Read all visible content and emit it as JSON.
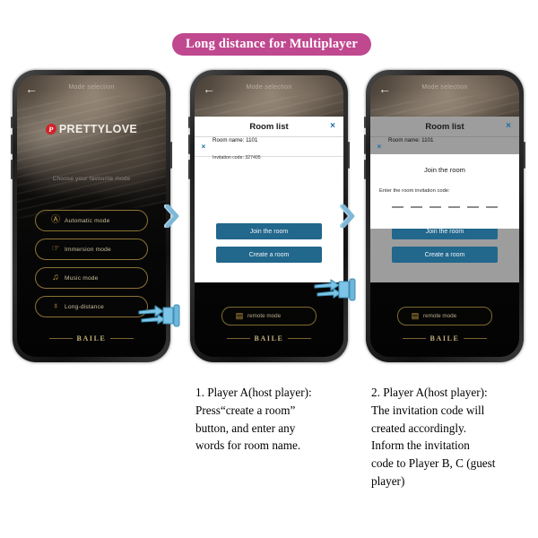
{
  "banner": {
    "text": "Long distance for Multiplayer"
  },
  "app": {
    "header": {
      "back_icon": "back-arrow-icon",
      "title": "Mode selection"
    },
    "logo": {
      "mark": "P",
      "text_part1": "PRETTY",
      "text_part2": "LOVE"
    },
    "subtitle": "Choose your favourite mode",
    "modes": [
      {
        "label": "Automatic mode",
        "icon": "circle-a-icon",
        "glyph": "Ⓐ"
      },
      {
        "label": "Immersion mode",
        "icon": "hand-touch-icon",
        "glyph": "☞"
      },
      {
        "label": "Music mode",
        "icon": "music-note-icon",
        "glyph": "♫"
      },
      {
        "label": "Long-distance",
        "icon": "globe-lock-icon",
        "glyph": "♁"
      }
    ],
    "remote": {
      "label": "remote mode",
      "icon": "remote-control-icon",
      "glyph": "▤"
    },
    "footer": {
      "brand": "BAILE"
    }
  },
  "room_list": {
    "title": "Room list",
    "close_icon": "close-icon",
    "close_glyph": "×",
    "entry": {
      "remove_icon": "remove-room-icon",
      "remove_glyph": "×",
      "room_name_label": "Room name: 1101",
      "invitation_code_label": "Invitation code:  327405"
    },
    "buttons": {
      "join": "Join the room",
      "create": "Create a room"
    }
  },
  "join_dialog": {
    "title": "Join the room",
    "hint": "Enter the room invitation code:",
    "slot_count": 6
  },
  "arrows": {
    "icon": "chevron-right-icon",
    "count_per_group": 3,
    "color_light": "#a9d3ea",
    "color_mid": "#7fb7d6"
  },
  "hand_cursor": {
    "icon": "pointing-hand-icon",
    "color": "#7ec4e6"
  },
  "captions": [
    {
      "lines": [
        "1. Player A(host player):",
        "Press“create a room”",
        "button, and enter any",
        "words for room name."
      ]
    },
    {
      "lines": [
        "2. Player A(host player):",
        "The invitation code will",
        "created accordingly.",
        "Inform the invitation",
        "code to Player B, C (guest",
        "player)"
      ]
    }
  ],
  "colors": {
    "banner_bg": "#c0488f",
    "button_teal": "#22678c",
    "gold": "#8c7334",
    "logo_red": "#d2232a"
  }
}
